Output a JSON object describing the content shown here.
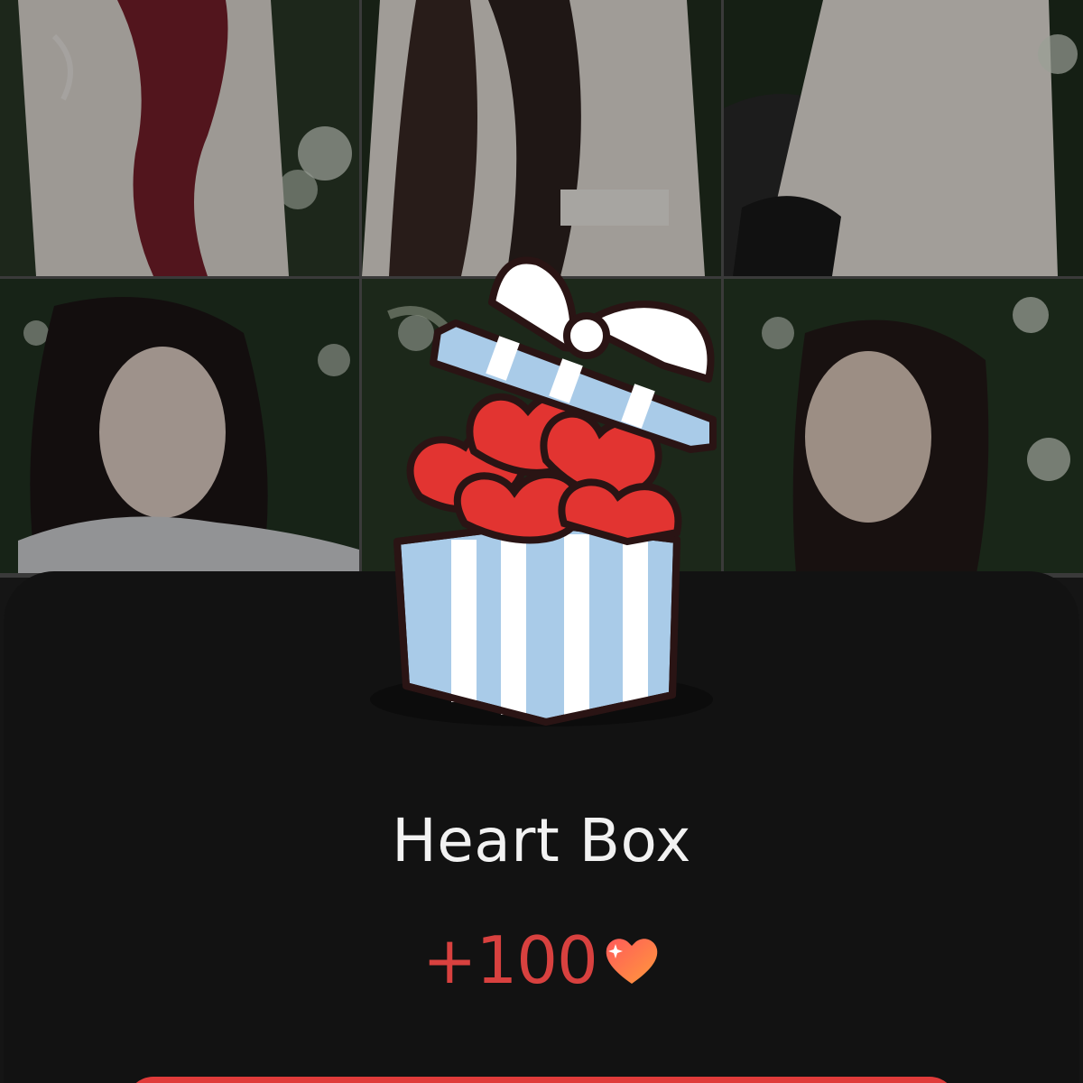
{
  "photos": [
    {
      "name": "photo-1"
    },
    {
      "name": "photo-2"
    },
    {
      "name": "photo-3"
    },
    {
      "name": "photo-4"
    },
    {
      "name": "photo-5"
    },
    {
      "name": "photo-6"
    }
  ],
  "reward": {
    "title": "Heart Box",
    "amount": "+100",
    "icon": "heart-icon"
  },
  "colors": {
    "accent": "#e03b3a",
    "amount_text": "#d8413f",
    "sheet_bg": "#121212",
    "box_blue": "#a9cbe8",
    "heart_red": "#e23431"
  }
}
